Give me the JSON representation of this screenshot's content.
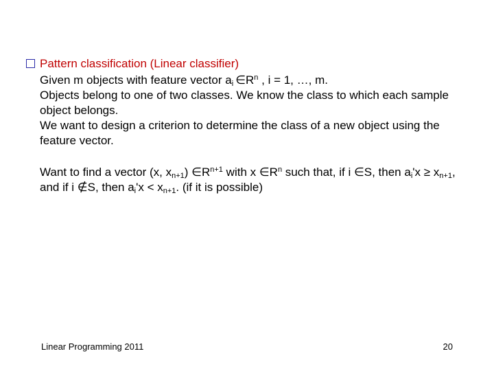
{
  "title": "Pattern classification (Linear classifier)",
  "line1_prefix": "Given m objects with feature vector a",
  "line1_sub_i": "i ",
  "line1_in": "∈R",
  "line1_sup_n": "n",
  "line1_suffix": " , i = 1, …, m.",
  "line2": "Objects belong to one of two classes.  We know the class to which each sample object belongs.",
  "line3": "We want to design a criterion to determine the class of a new object using the feature vector.",
  "p2_a": "Want to find a vector (x, x",
  "p2_sub_np1_a": "n+1",
  "p2_b": ") ∈R",
  "p2_sup_np1": "n+1",
  "p2_c": "  with x ∈R",
  "p2_sup_n": "n",
  "p2_d": "  such that, if i ∈S, then a",
  "p2_sub_i_a": "i",
  "p2_e": "'x ≥ x",
  "p2_sub_np1_b": "n+1",
  "p2_f": ", and  if  i ∉S, then  a",
  "p2_sub_i_b": "i",
  "p2_g": "'x < x",
  "p2_sub_np1_c": "n+1",
  "p2_h": ". (if it is possible)",
  "footer_left": "Linear Programming 2011",
  "footer_right": "20"
}
